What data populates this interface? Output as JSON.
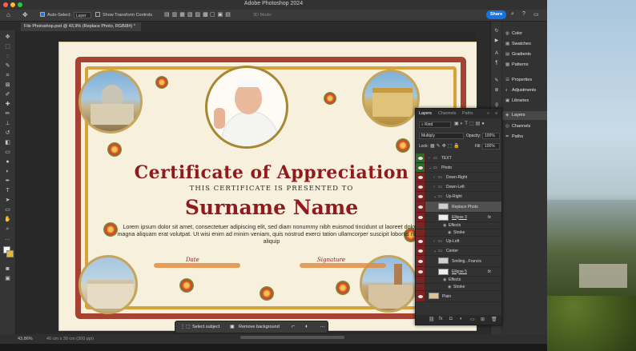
{
  "window": {
    "title": "Adobe Photoshop 2024"
  },
  "options_bar": {
    "auto_select_label": "Auto-Select:",
    "auto_select_value": "Layer",
    "show_transform_label": "Show Transform Controls",
    "mode_3d": "3D Mode:",
    "share_label": "Share"
  },
  "document": {
    "tab_title": "File Photoshop.psd @ 43,9% (Replace Photo, RGB/8#) *"
  },
  "certificate": {
    "title": "Certificate of Appreciation",
    "subtitle": "THIS CERTIFICATE IS PRESENTED TO",
    "name": "Surname Name",
    "body": "Lorem ipsum dolor sit amet, consectetuer adipiscing elit, sed diam nonummy nibh euismod tincidunt ut laoreet dolore magna aliquam erat volutpat. Ut wisi enim ad minim veniam, quis nostrud exerci tation ullamcorper suscipit lobortis nisl ut aliquip",
    "date_label": "Date",
    "signature_label": "Signature"
  },
  "floating_toolbar": {
    "select_subject": "Select subject",
    "remove_background": "Remove background"
  },
  "status_bar": {
    "zoom": "43,86%",
    "doc_size": "40 cm x 30 cm (300 ppi)"
  },
  "right_panels": [
    {
      "icon": "color-icon",
      "label": "Color"
    },
    {
      "icon": "swatches-icon",
      "label": "Swatches"
    },
    {
      "icon": "gradients-icon",
      "label": "Gradients"
    },
    {
      "icon": "patterns-icon",
      "label": "Patterns"
    },
    {
      "icon": "properties-icon",
      "label": "Properties"
    },
    {
      "icon": "adjustments-icon",
      "label": "Adjustments"
    },
    {
      "icon": "libraries-icon",
      "label": "Libraries"
    },
    {
      "icon": "layers-icon",
      "label": "Layers"
    },
    {
      "icon": "channels-icon",
      "label": "Channels"
    },
    {
      "icon": "paths-icon",
      "label": "Paths"
    }
  ],
  "layers_panel": {
    "tabs": [
      "Layers",
      "Channels",
      "Paths"
    ],
    "filter": "Kind",
    "blend_mode": "Multiply",
    "opacity_label": "Opacity:",
    "opacity": "100%",
    "lock_label": "Lock:",
    "fill_label": "Fill:",
    "fill": "100%",
    "layers": [
      {
        "name": "TEXT",
        "type": "group",
        "indent": 0
      },
      {
        "name": "Photo",
        "type": "group",
        "indent": 0
      },
      {
        "name": "Down-Right",
        "type": "group",
        "indent": 1
      },
      {
        "name": "Down-Left",
        "type": "group",
        "indent": 1
      },
      {
        "name": "Up-Right",
        "type": "group",
        "indent": 1
      },
      {
        "name": "Replace Photo",
        "type": "smart",
        "indent": 2,
        "selected": true
      },
      {
        "name": "Ellipse 3",
        "type": "shape",
        "indent": 2,
        "fx": "fx"
      },
      {
        "name": "Effects",
        "type": "effect",
        "indent": 3
      },
      {
        "name": "Stroke",
        "type": "effect",
        "indent": 4
      },
      {
        "name": "Up-Left",
        "type": "group",
        "indent": 1
      },
      {
        "name": "Center",
        "type": "group",
        "indent": 1
      },
      {
        "name": "Smiling...Francis",
        "type": "smart",
        "indent": 2
      },
      {
        "name": "Ellipse 5",
        "type": "shape",
        "indent": 2,
        "fx": "fx"
      },
      {
        "name": "Effects",
        "type": "effect",
        "indent": 3
      },
      {
        "name": "Stroke",
        "type": "effect",
        "indent": 4
      },
      {
        "name": "Plain",
        "type": "image",
        "indent": 0
      }
    ]
  }
}
